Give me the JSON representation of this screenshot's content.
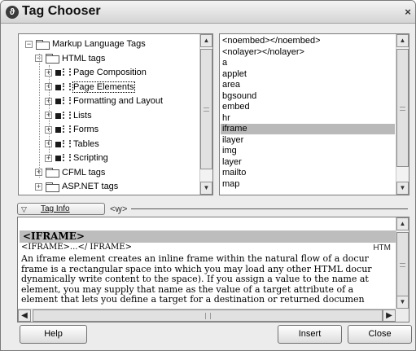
{
  "window": {
    "title": "Tag Chooser",
    "app_icon": "dreamweaver-icon",
    "close_glyph": "×"
  },
  "tree": {
    "items": [
      {
        "label": "Markup Language Tags",
        "expander": "−",
        "type": "folder",
        "depth": 0
      },
      {
        "label": "HTML tags",
        "expander": "−",
        "type": "folder",
        "depth": 1
      },
      {
        "label": "Page Composition",
        "expander": "+",
        "type": "tag",
        "depth": 2
      },
      {
        "label": "Page Elements",
        "expander": "+",
        "type": "tag",
        "depth": 2,
        "focused": true
      },
      {
        "label": "Formatting and Layout",
        "expander": "+",
        "type": "tag",
        "depth": 2
      },
      {
        "label": "Lists",
        "expander": "+",
        "type": "tag",
        "depth": 2
      },
      {
        "label": "Forms",
        "expander": "+",
        "type": "tag",
        "depth": 2
      },
      {
        "label": "Tables",
        "expander": "+",
        "type": "tag",
        "depth": 2
      },
      {
        "label": "Scripting",
        "expander": "+",
        "type": "tag",
        "depth": 2
      },
      {
        "label": "CFML tags",
        "expander": "+",
        "type": "folder",
        "depth": 1
      },
      {
        "label": "ASP.NET tags",
        "expander": "+",
        "type": "folder",
        "depth": 1
      }
    ]
  },
  "tag_list": {
    "items": [
      "<noembed></noembed>",
      "<nolayer></nolayer>",
      "a",
      "applet",
      "area",
      "bgsound",
      "embed",
      "hr",
      "iframe",
      "ilayer",
      "img",
      "layer",
      "mailto",
      "map"
    ],
    "selected": "iframe"
  },
  "tag_info": {
    "tab_label": "Tag Info",
    "toggle_glyph": "▽",
    "code_glyph": "<ꝡ>"
  },
  "reference": {
    "heading": "<IFRAME>",
    "syntax": "<IFRAME>...</ IFRAME>",
    "source_label": "HTM",
    "lines": [
      "An iframe element creates an inline frame within the natural flow of a docur",
      "frame is a rectangular space into which you may load any other HTML docur",
      "dynamically write content to the space). If you assign a value to the name at",
      "element, you may supply that name as the value of a target attribute of a",
      "element that lets you define a target for a destination or returned documen"
    ]
  },
  "buttons": {
    "help": "Help",
    "insert": "Insert",
    "close": "Close"
  },
  "colors": {
    "selection": "#b9b9b9",
    "window_bg": "#ececec"
  }
}
